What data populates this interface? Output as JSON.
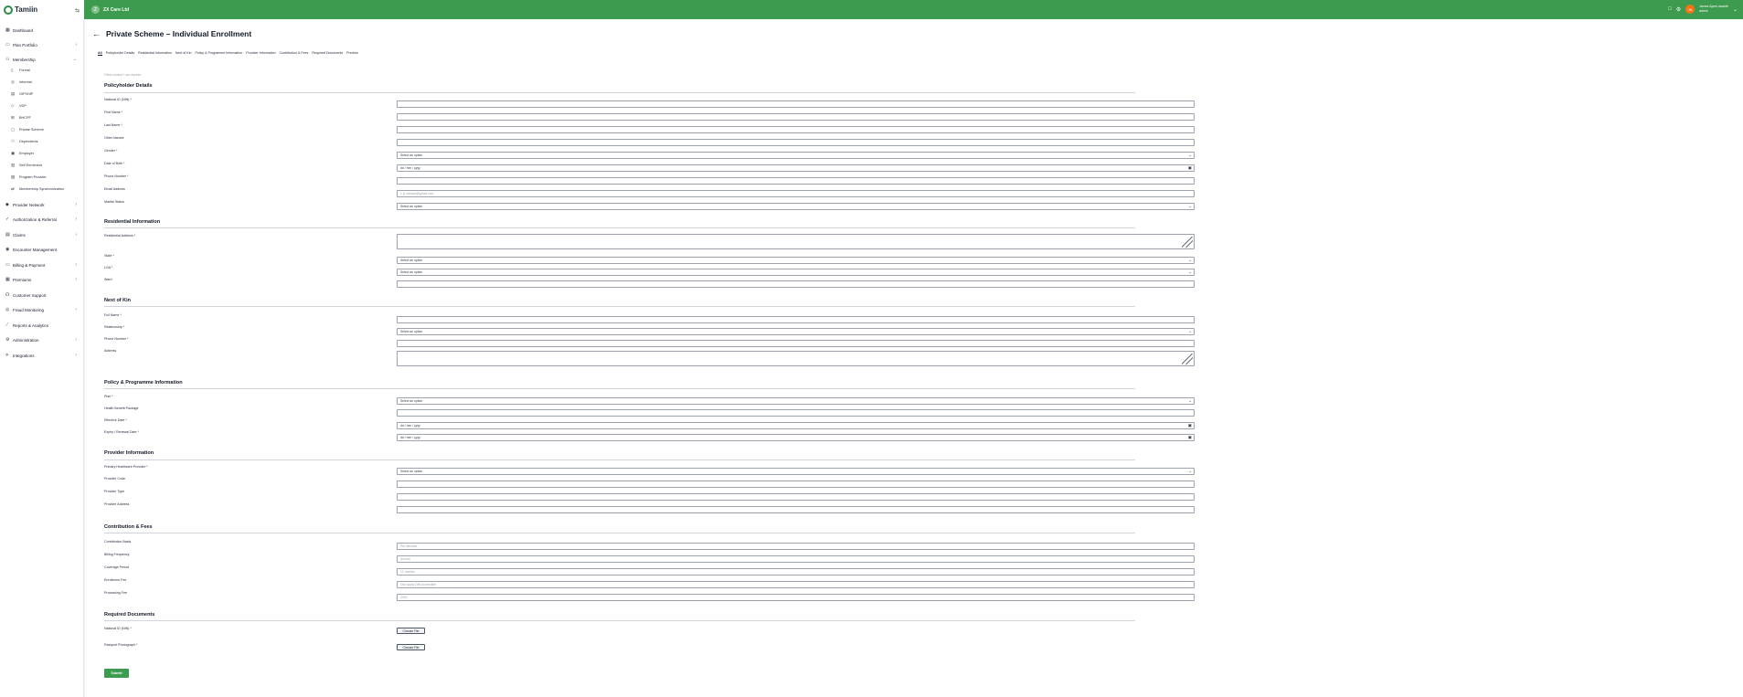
{
  "brand": {
    "name": "Tamiin",
    "org_name": "ZX Care Ltd",
    "org_initial": "Z"
  },
  "user": {
    "initials": "JA",
    "name": "James Ayeni-Asante",
    "role": "admin"
  },
  "sidebar": {
    "items": [
      {
        "label": "Dashboard",
        "icon": "grid-icon"
      },
      {
        "label": "Plan Portfolio",
        "icon": "folder-icon"
      },
      {
        "label": "Membership",
        "icon": "users-icon"
      },
      {
        "label": "Provider Network",
        "icon": "network-icon"
      },
      {
        "label": "Authorization & Referral",
        "icon": "check-icon"
      },
      {
        "label": "Claims",
        "icon": "document-icon"
      },
      {
        "label": "Encounter Management",
        "icon": "clipboard-icon"
      },
      {
        "label": "Billing & Payment",
        "icon": "card-icon"
      },
      {
        "label": "Premiums",
        "icon": "wallet-icon"
      },
      {
        "label": "Customer Support",
        "icon": "headset-icon"
      },
      {
        "label": "Fraud Monitoring",
        "icon": "shield-icon"
      },
      {
        "label": "Reports & Analytics",
        "icon": "chart-icon"
      },
      {
        "label": "Administration",
        "icon": "settings-icon"
      },
      {
        "label": "Integrations",
        "icon": "plug-icon"
      }
    ],
    "membership_sub": [
      "Formal",
      "Informal",
      "GIFSHIP",
      "VDP",
      "BHCPF",
      "Private Scheme",
      "Dependents",
      "Employer",
      "Self Enrolment",
      "Program Provider",
      "Membership Synchronization"
    ]
  },
  "page": {
    "title": "Private Scheme – Individual Enrollment",
    "form_hint": "Fields marked * are required"
  },
  "tabs": [
    "All",
    "Policyholder Details",
    "Residential Information",
    "Next of Kin",
    "Policy & Programme Information",
    "Provider Information",
    "Contribution & Fees",
    "Required Documents",
    "Preview"
  ],
  "sections": {
    "policyholder": {
      "title": "Policyholder Details",
      "fields": [
        {
          "label": "National ID (NIN) *",
          "value": "",
          "kind": "text"
        },
        {
          "label": "First Name *",
          "value": "",
          "kind": "text"
        },
        {
          "label": "Last Name *",
          "value": "",
          "kind": "text"
        },
        {
          "label": "Other Names",
          "value": "",
          "kind": "text"
        },
        {
          "label": "Gender *",
          "value": "Select an option",
          "kind": "select"
        },
        {
          "label": "Date of Birth *",
          "value": "dd / mm / yyyy",
          "kind": "date"
        },
        {
          "label": "Phone Number *",
          "value": "",
          "kind": "text"
        },
        {
          "label": "Email Address",
          "value": "e.g. sample@gmail.com",
          "kind": "placeholder"
        },
        {
          "label": "Marital Status",
          "value": "Select an option",
          "kind": "select"
        }
      ]
    },
    "residential": {
      "title": "Residential Information",
      "address_label": "Residential Address *",
      "fields": [
        {
          "label": "State *",
          "value": "Select an option",
          "kind": "select"
        },
        {
          "label": "LGA *",
          "value": "Select an option",
          "kind": "select"
        },
        {
          "label": "Ward",
          "value": "",
          "kind": "text"
        }
      ]
    },
    "nok": {
      "title": "Next of Kin",
      "fields": [
        {
          "label": "Full Name *",
          "value": "",
          "kind": "text"
        },
        {
          "label": "Relationship *",
          "value": "Select an option",
          "kind": "select"
        },
        {
          "label": "Phone Number *",
          "value": "",
          "kind": "text"
        }
      ],
      "address_label": "Address"
    },
    "policy": {
      "title": "Policy & Programme Information",
      "fields": [
        {
          "label": "Plan *",
          "value": "Select an option",
          "kind": "select"
        },
        {
          "label": "Health Benefit Package",
          "value": "",
          "kind": "text"
        },
        {
          "label": "Effective Date *",
          "value": "dd / mm / yyyy",
          "kind": "date"
        },
        {
          "label": "Expiry / Renewal Date *",
          "value": "dd / mm / yyyy",
          "kind": "date"
        }
      ]
    },
    "provider": {
      "title": "Provider Information",
      "fields": [
        {
          "label": "Primary Healthcare Provider *",
          "value": "Select an option",
          "kind": "select"
        },
        {
          "label": "Provider Code",
          "value": "",
          "kind": "text"
        },
        {
          "label": "Provider Type",
          "value": "",
          "kind": "text"
        },
        {
          "label": "Provider Address",
          "value": "",
          "kind": "text"
        }
      ]
    },
    "contribution": {
      "title": "Contribution & Fees",
      "fields": [
        {
          "label": "Contribution Basis",
          "value": "Per Member",
          "kind": "placeholder"
        },
        {
          "label": "Billing Frequency",
          "value": "Annual",
          "kind": "placeholder"
        },
        {
          "label": "Coverage Period",
          "value": "12 months",
          "kind": "placeholder"
        },
        {
          "label": "Enrollment Fee",
          "value": "Use Apply Drill Accessible",
          "kind": "placeholder"
        },
        {
          "label": "Processing Fee",
          "value": "2000",
          "kind": "placeholder"
        }
      ]
    },
    "documents": {
      "title": "Required Documents",
      "fields": [
        {
          "label": "National ID (NIN) *",
          "button": "Choose File"
        },
        {
          "label": "Passport Photograph *",
          "button": "Choose File"
        }
      ]
    }
  },
  "submit_label": "Submit"
}
